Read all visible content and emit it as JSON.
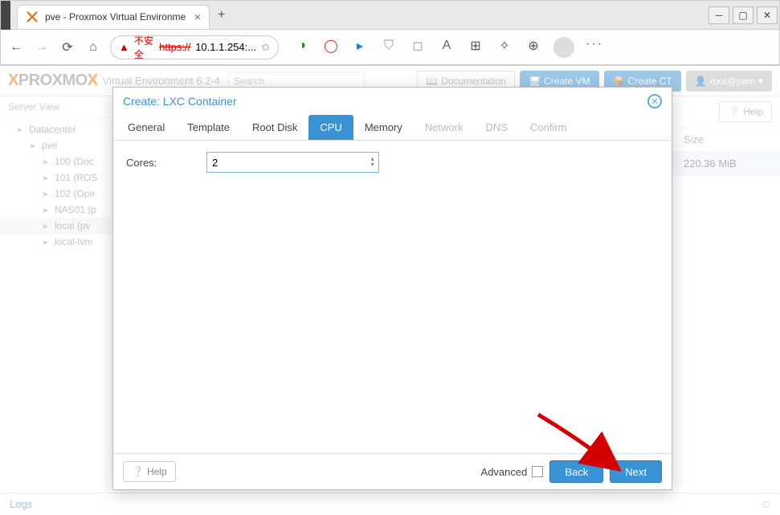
{
  "browser": {
    "tab_title": "pve - Proxmox Virtual Environme",
    "url_warn": "不安全",
    "url_proto": "https://",
    "url_rest": "10.1.1.254:..."
  },
  "pve_header": {
    "version": "Virtual Environment 6.2-4",
    "search_placeholder": "Search",
    "doc_btn": "Documentation",
    "create_vm": "Create VM",
    "create_ct": "Create CT",
    "user": "root@pam"
  },
  "sidebar": {
    "header": "Server View",
    "items": [
      {
        "label": "Datacenter",
        "level": 1
      },
      {
        "label": "pve",
        "level": 2
      },
      {
        "label": "100 (Doc",
        "level": 3
      },
      {
        "label": "101 (ROS",
        "level": 3
      },
      {
        "label": "102 (Ope",
        "level": 3
      },
      {
        "label": "NAS01 (p",
        "level": 3
      },
      {
        "label": "local (pv",
        "level": 3,
        "selected": true
      },
      {
        "label": "local-lvm",
        "level": 3
      }
    ]
  },
  "main": {
    "help": "Help",
    "col_size": "Size",
    "row_size": "220.36 MiB"
  },
  "logs_label": "Logs",
  "modal": {
    "title": "Create: LXC Container",
    "tabs": [
      {
        "label": "General",
        "state": ""
      },
      {
        "label": "Template",
        "state": ""
      },
      {
        "label": "Root Disk",
        "state": ""
      },
      {
        "label": "CPU",
        "state": "act"
      },
      {
        "label": "Memory",
        "state": ""
      },
      {
        "label": "Network",
        "state": "dis"
      },
      {
        "label": "DNS",
        "state": "dis"
      },
      {
        "label": "Confirm",
        "state": "dis"
      }
    ],
    "cores_label": "Cores:",
    "cores_value": "2",
    "footer": {
      "help": "Help",
      "advanced": "Advanced",
      "back": "Back",
      "next": "Next"
    }
  }
}
